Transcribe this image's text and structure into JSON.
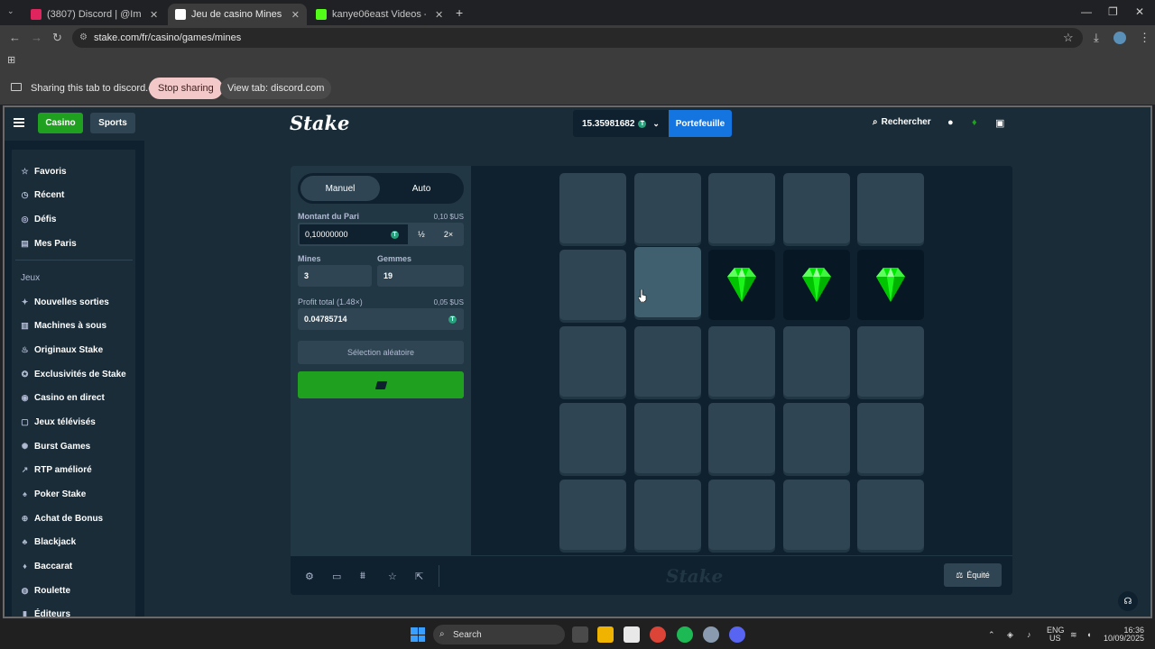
{
  "browser": {
    "tabs": [
      {
        "label": "(3807) Discord | @ImNF...",
        "favicon_color": "#e0245e"
      },
      {
        "label": "Jeu de casino Mines - Joue...",
        "favicon_color": "#ffffff"
      },
      {
        "label": "kanye06east Videos - Watch C...",
        "favicon_color": "#53fc18"
      }
    ],
    "url": "stake.com/fr/casino/games/mines",
    "share_text": "Sharing this tab to discord.com",
    "stop_label": "Stop sharing",
    "view_label": "View tab: discord.com"
  },
  "topnav": {
    "casino_label": "Casino",
    "sports_label": "Sports",
    "logo": "Stake",
    "balance": "15.35981682",
    "currency_symbol": "T",
    "wallet_label": "Portefeuille",
    "search_label": "Rechercher"
  },
  "sidebar": {
    "top_items": [
      {
        "label": "Favoris",
        "icon": "star-icon"
      },
      {
        "label": "Récent",
        "icon": "clock-icon"
      },
      {
        "label": "Défis",
        "icon": "target-icon"
      },
      {
        "label": "Mes Paris",
        "icon": "list-icon"
      }
    ],
    "section_title": "Jeux",
    "game_items": [
      {
        "label": "Nouvelles sorties"
      },
      {
        "label": "Machines à sous"
      },
      {
        "label": "Originaux Stake"
      },
      {
        "label": "Exclusivités de Stake"
      },
      {
        "label": "Casino en direct"
      },
      {
        "label": "Jeux télévisés"
      },
      {
        "label": "Burst Games"
      },
      {
        "label": "RTP amélioré"
      },
      {
        "label": "Poker Stake"
      },
      {
        "label": "Achat de Bonus"
      },
      {
        "label": "Blackjack"
      },
      {
        "label": "Baccarat"
      },
      {
        "label": "Roulette"
      },
      {
        "label": "Éditeurs"
      }
    ]
  },
  "panel": {
    "mode_manual": "Manuel",
    "mode_auto": "Auto",
    "bet_label": "Montant du Pari",
    "bet_usd": "0,10 $US",
    "bet_value": "0,10000000",
    "half_label": "½",
    "double_label": "2×",
    "mines_label": "Mines",
    "mines_value": "3",
    "gems_label": "Gemmes",
    "gems_value": "19",
    "profit_label": "Profit total (1.48×)",
    "profit_usd": "0,05 $US",
    "profit_value": "0.04785714",
    "random_label": "Sélection aléatoire"
  },
  "board": {
    "rows": 5,
    "cols": 5,
    "revealed_gems": [
      7,
      8,
      9
    ],
    "hovered_tile": 6,
    "gem_color": "#00e701"
  },
  "footer": {
    "watermark": "Stake",
    "fairness_label": "Équité"
  },
  "taskbar": {
    "search_label": "Search",
    "lang_1": "ENG",
    "lang_2": "US",
    "time": "16:36",
    "date": "10/09/2025"
  }
}
